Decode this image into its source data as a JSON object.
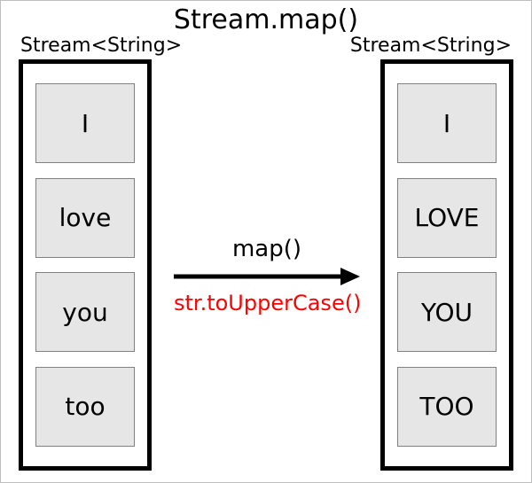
{
  "title": "Stream.map()",
  "input_stream": {
    "type_label": "Stream<String>",
    "items": [
      "I",
      "love",
      "you",
      "too"
    ]
  },
  "output_stream": {
    "type_label": "Stream<String>",
    "items": [
      "I",
      "LOVE",
      "YOU",
      "TOO"
    ]
  },
  "operation": {
    "method": "map()",
    "mapper": "str.toUpperCase()"
  },
  "colors": {
    "mapper_text": "#ff0000",
    "cell_fill": "#e6e6e6",
    "cell_border": "#808080",
    "stream_border": "#000000"
  }
}
